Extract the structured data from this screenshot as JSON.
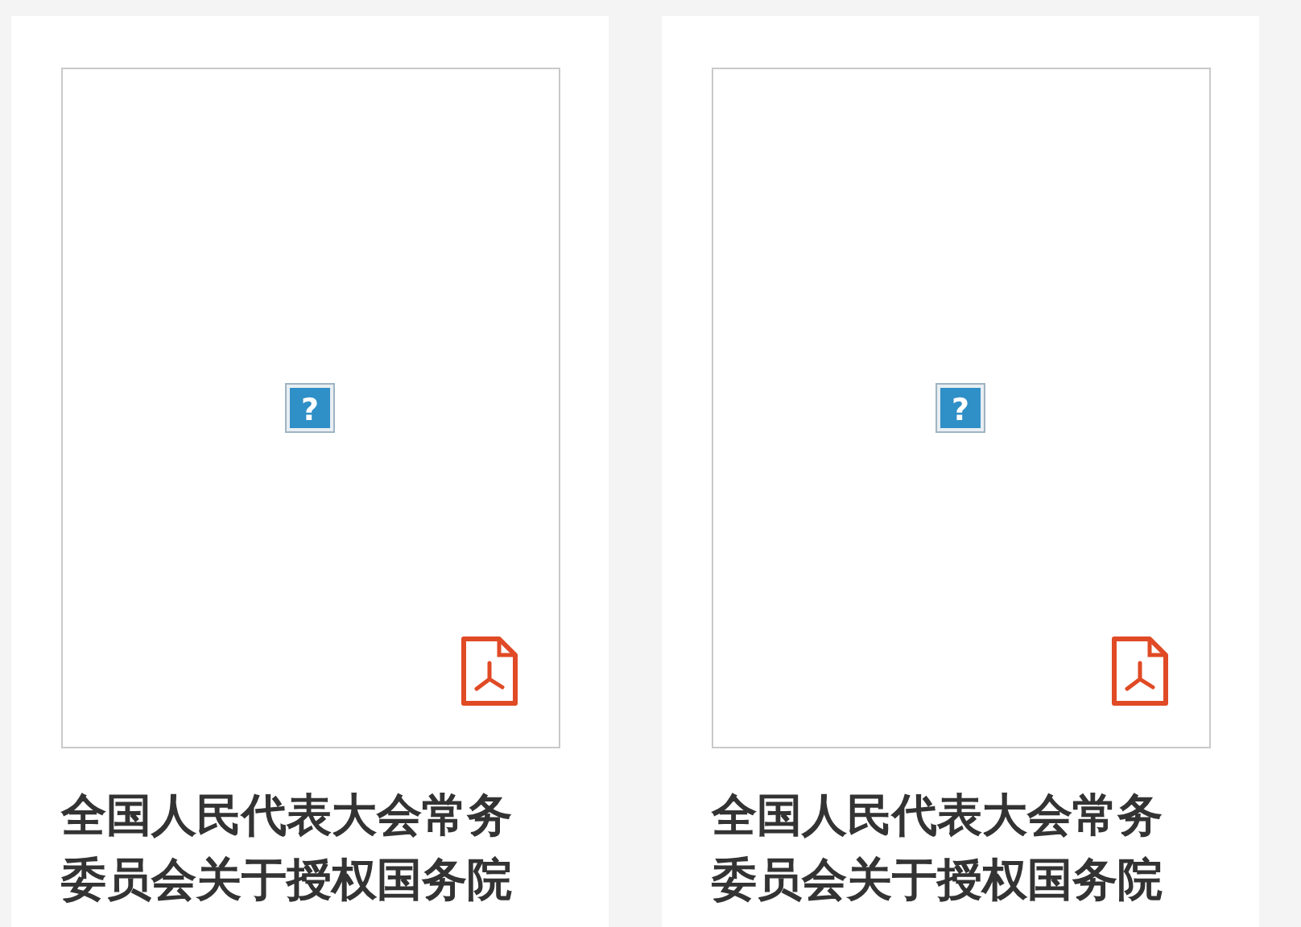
{
  "documents": [
    {
      "title_lines": [
        "全国人民代表大会常务",
        "委员会关于授权国务院"
      ],
      "placeholder_icon": {
        "kind": "broken-image",
        "glyph": "?"
      },
      "file_icon": {
        "kind": "pdf"
      }
    },
    {
      "title_lines": [
        "全国人民代表大会常务",
        "委员会关于授权国务院"
      ],
      "placeholder_icon": {
        "kind": "broken-image",
        "glyph": "?"
      },
      "file_icon": {
        "kind": "pdf"
      }
    }
  ]
}
